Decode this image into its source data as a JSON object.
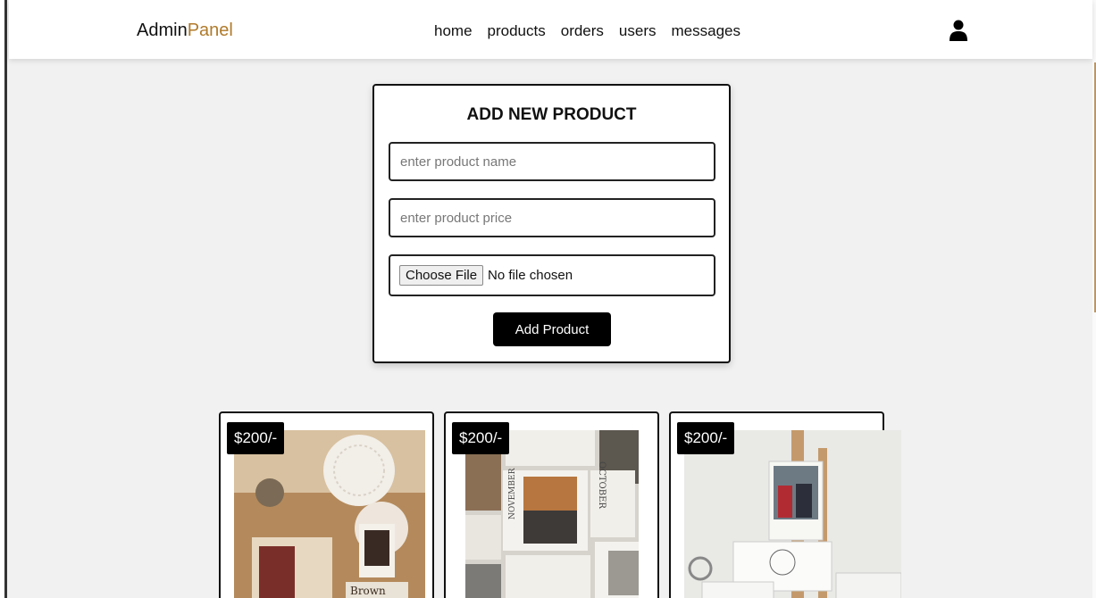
{
  "header": {
    "logo_main": "Admin",
    "logo_accent": "Panel",
    "nav": [
      "home",
      "products",
      "orders",
      "users",
      "messages"
    ]
  },
  "form": {
    "title": "ADD NEW PRODUCT",
    "name_placeholder": "enter product name",
    "price_placeholder": "enter product price",
    "file_button": "Choose File",
    "file_status": "No file chosen",
    "submit_label": "Add Product"
  },
  "products": [
    {
      "price": "$200/-",
      "image": "scrapbook-collage"
    },
    {
      "price": "$200/-",
      "image": "calendar-collage"
    },
    {
      "price": "$200/-",
      "image": "photo-easel"
    }
  ],
  "colors": {
    "accent": "#b07a2a",
    "button": "#000000",
    "background": "#f1f1f1"
  }
}
